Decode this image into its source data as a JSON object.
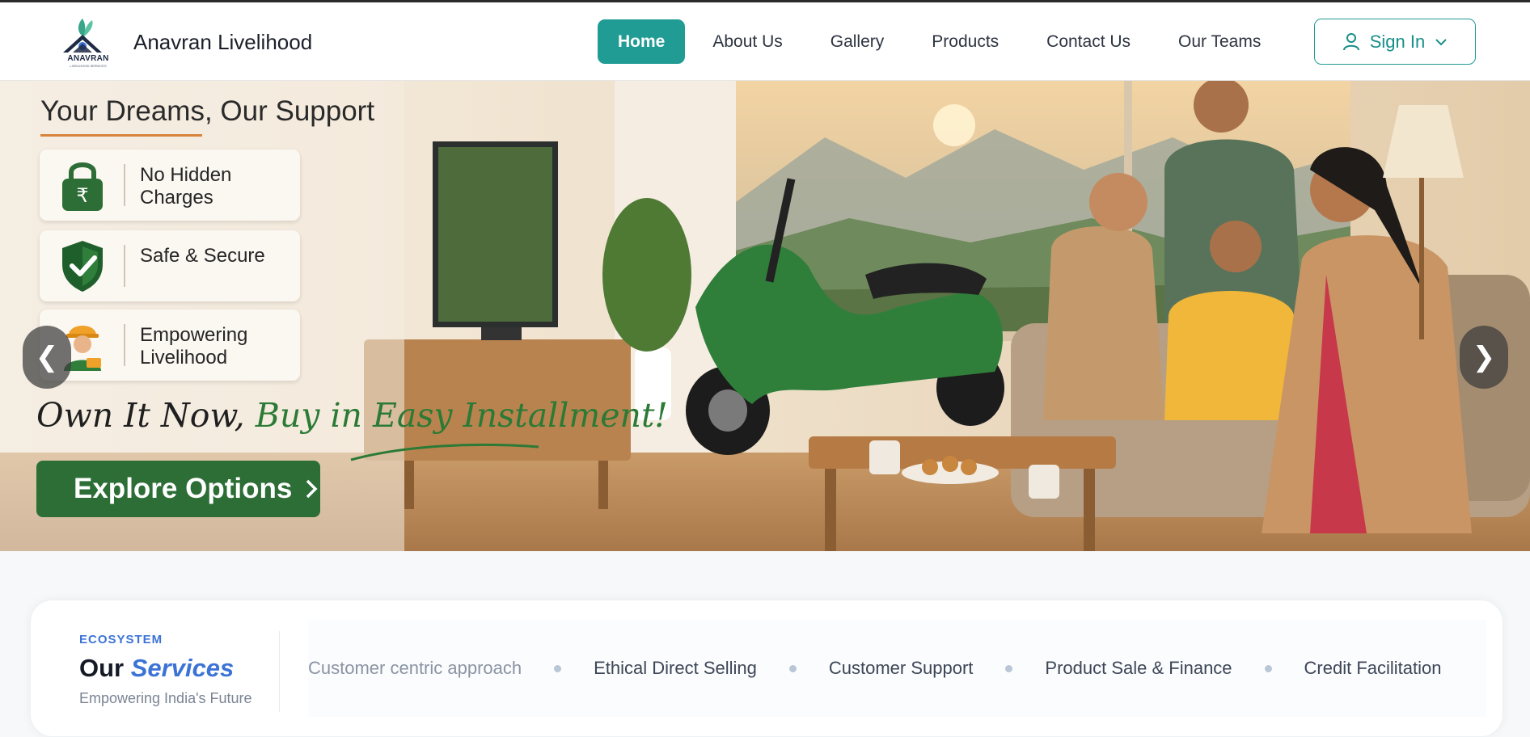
{
  "header": {
    "logo": {
      "name": "ANAVRAN",
      "sub": "LIVELIHOOD SERVICES"
    },
    "brand": "Anavran Livelihood",
    "nav": [
      {
        "label": "Home",
        "active": true
      },
      {
        "label": "About Us"
      },
      {
        "label": "Gallery"
      },
      {
        "label": "Products"
      },
      {
        "label": "Contact Us"
      },
      {
        "label": "Our Teams"
      }
    ],
    "signin": {
      "label": "Sign In",
      "icon": "user-icon",
      "chevron": "chevron-down-icon"
    }
  },
  "hero": {
    "title": "Your Dreams, Our Support",
    "features": [
      {
        "label": "No Hidden Charges",
        "icon": "rupee-lock-icon"
      },
      {
        "label": "Safe & Secure",
        "icon": "shield-check-icon"
      },
      {
        "label": "Empowering Livelihood",
        "icon": "worker-icon"
      }
    ],
    "tagline_part1": "Own It Now, ",
    "tagline_part2": "Buy in Easy Installment!",
    "cta": "Explore Options",
    "cta_icon": "chevron-right-icon",
    "prev": "❮",
    "next": "❯"
  },
  "services": {
    "eyebrow": "ECOSYSTEM",
    "title_plain": "Our ",
    "title_em": "Services",
    "subtitle": "Empowering India's Future",
    "items": [
      "Customer centric approach",
      "Ethical Direct Selling",
      "Customer Support",
      "Product Sale & Finance",
      "Credit Facilitation"
    ]
  },
  "colors": {
    "accent": "#209c94",
    "brand_green": "#2c6e35",
    "service_blue": "#3b73d6"
  }
}
